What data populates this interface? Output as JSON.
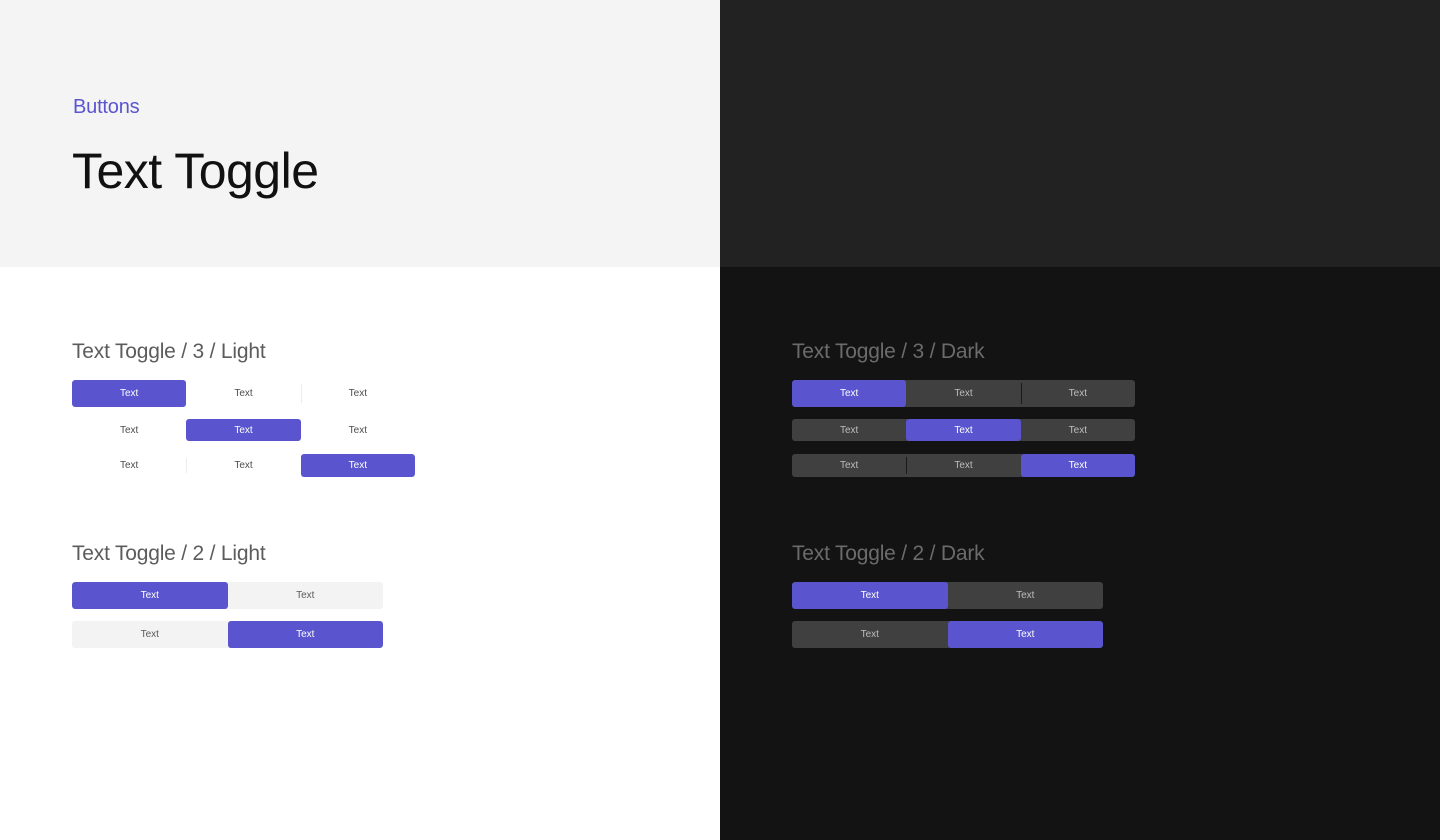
{
  "header": {
    "category": "Buttons",
    "title": "Text Toggle"
  },
  "colors": {
    "accent": "#5a55cf",
    "light_header_bg": "#f4f4f4",
    "dark_header_bg": "#222222",
    "light_bg": "#ffffff",
    "dark_bg": "#131313",
    "dark_toggle_bg": "#404040",
    "light_toggle2_bg": "#f3f3f3"
  },
  "sections": {
    "light3": {
      "title": "Text Toggle / 3 / Light",
      "rows": [
        {
          "options": [
            "Text",
            "Text",
            "Text"
          ],
          "selected": 0
        },
        {
          "options": [
            "Text",
            "Text",
            "Text"
          ],
          "selected": 1
        },
        {
          "options": [
            "Text",
            "Text",
            "Text"
          ],
          "selected": 2
        }
      ]
    },
    "dark3": {
      "title": "Text Toggle / 3 / Dark",
      "rows": [
        {
          "options": [
            "Text",
            "Text",
            "Text"
          ],
          "selected": 0
        },
        {
          "options": [
            "Text",
            "Text",
            "Text"
          ],
          "selected": 1
        },
        {
          "options": [
            "Text",
            "Text",
            "Text"
          ],
          "selected": 2
        }
      ]
    },
    "light2": {
      "title": "Text Toggle / 2 / Light",
      "rows": [
        {
          "options": [
            "Text",
            "Text"
          ],
          "selected": 0
        },
        {
          "options": [
            "Text",
            "Text"
          ],
          "selected": 1
        }
      ]
    },
    "dark2": {
      "title": "Text Toggle / 2 / Dark",
      "rows": [
        {
          "options": [
            "Text",
            "Text"
          ],
          "selected": 0
        },
        {
          "options": [
            "Text",
            "Text"
          ],
          "selected": 1
        }
      ]
    }
  }
}
